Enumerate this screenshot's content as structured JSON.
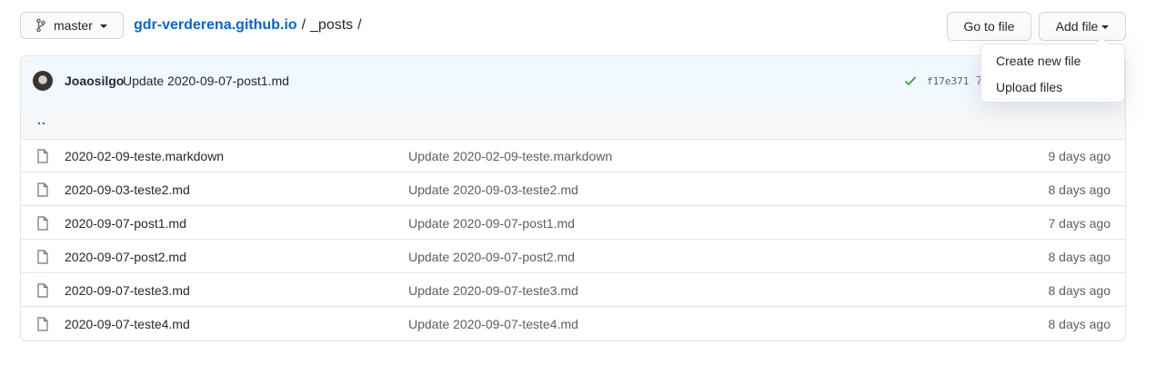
{
  "branch": {
    "label": "master",
    "icon": "git-branch-icon"
  },
  "breadcrumb": {
    "repo": "gdr-verderena.github.io",
    "sep1": "/",
    "folder": "_posts",
    "sep2": "/"
  },
  "buttons": {
    "goto_file": "Go to file",
    "add_file": "Add file"
  },
  "add_file_menu": {
    "items": [
      "Create new file",
      "Upload files"
    ]
  },
  "commit": {
    "author": "Joaosilgo",
    "message": "Update 2020-09-07-post1.md",
    "status_icon": "check-icon",
    "sha": "f17e371",
    "time_partial": "7"
  },
  "parent_dir": "..",
  "files": [
    {
      "name": "2020-02-09-teste.markdown",
      "message": "Update 2020-02-09-teste.markdown",
      "time": "9 days ago",
      "icon": "file-icon"
    },
    {
      "name": "2020-09-03-teste2.md",
      "message": "Update 2020-09-03-teste2.md",
      "time": "8 days ago",
      "icon": "file-icon"
    },
    {
      "name": "2020-09-07-post1.md",
      "message": "Update 2020-09-07-post1.md",
      "time": "7 days ago",
      "icon": "file-icon"
    },
    {
      "name": "2020-09-07-post2.md",
      "message": "Update 2020-09-07-post2.md",
      "time": "8 days ago",
      "icon": "file-icon"
    },
    {
      "name": "2020-09-07-teste3.md",
      "message": "Update 2020-09-07-teste3.md",
      "time": "8 days ago",
      "icon": "file-icon"
    },
    {
      "name": "2020-09-07-teste4.md",
      "message": "Update 2020-09-07-teste4.md",
      "time": "8 days ago",
      "icon": "file-icon"
    }
  ],
  "colors": {
    "link": "#0366d6",
    "success": "#28a745",
    "muted": "#586069",
    "commit_bg": "#f1f8ff"
  }
}
